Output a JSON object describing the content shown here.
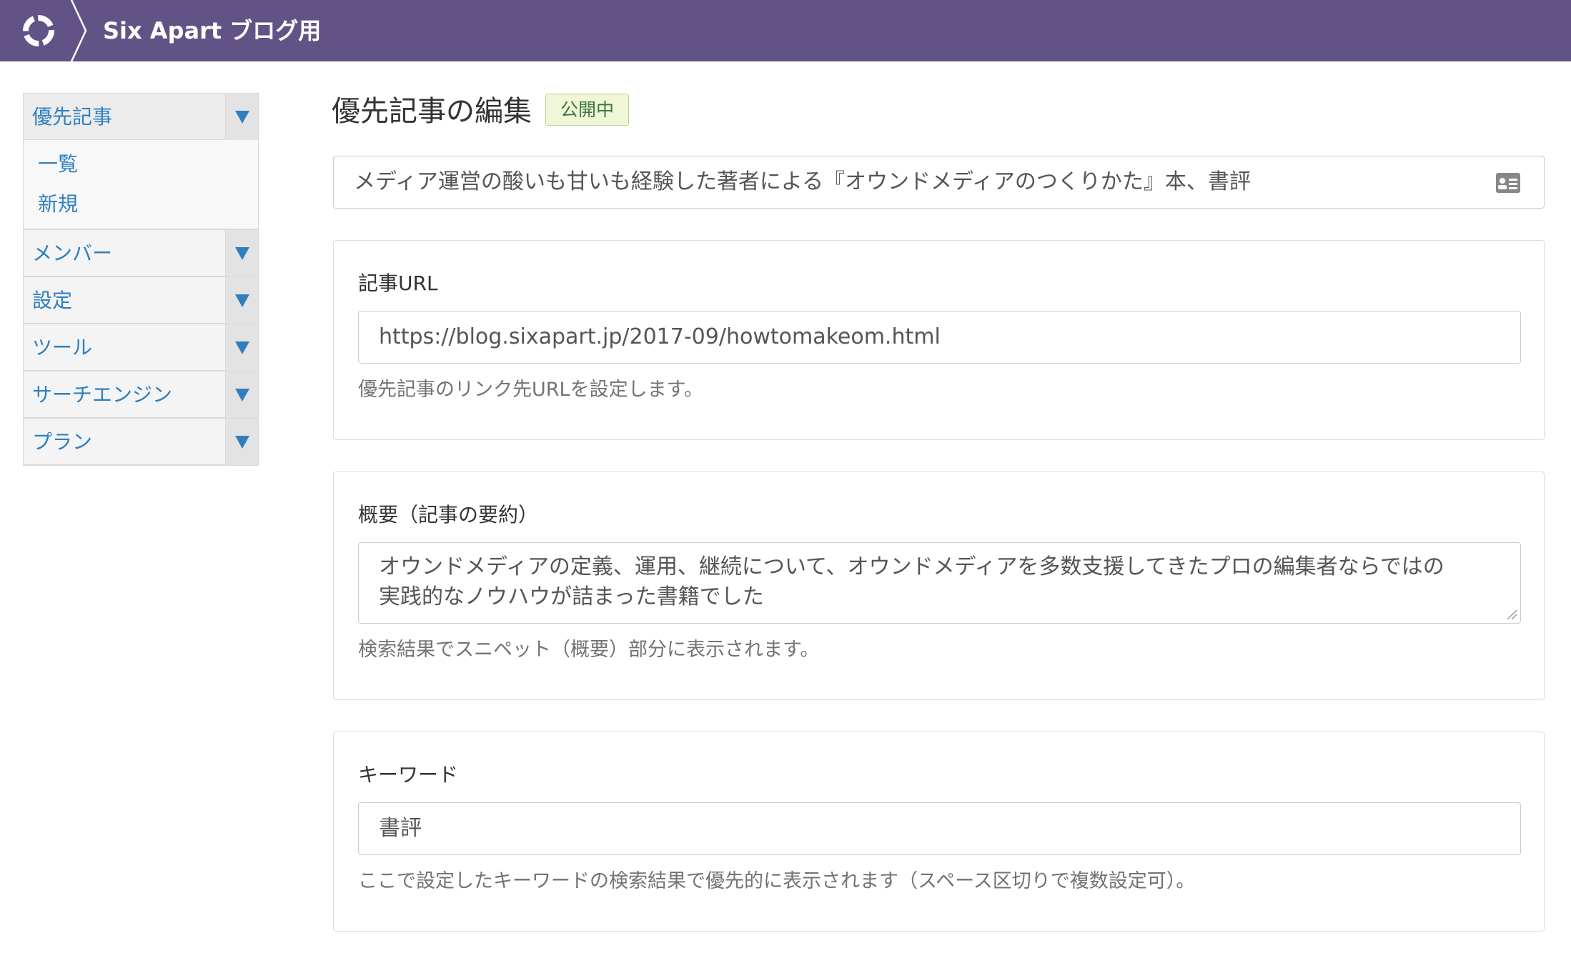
{
  "header": {
    "logo_icon": "sixapart-ring-icon",
    "site_title": "Six Apart ブログ用",
    "bar_color": "#625386"
  },
  "sidebar": {
    "groups": [
      {
        "label": "優先記事",
        "expanded": true,
        "items": [
          {
            "label": "一覧"
          },
          {
            "label": "新規"
          }
        ]
      },
      {
        "label": "メンバー",
        "expanded": false
      },
      {
        "label": "設定",
        "expanded": false
      },
      {
        "label": "ツール",
        "expanded": false
      },
      {
        "label": "サーチエンジン",
        "expanded": false
      },
      {
        "label": "プラン",
        "expanded": false
      }
    ],
    "toggle_icon": "triangle-down-icon",
    "link_color": "#2f7fbf"
  },
  "main": {
    "page_title": "優先記事の編集",
    "status_badge": "公開中",
    "article_title": "メディア運営の酸いも甘いも経験した著者による『オウンドメディアのつくりかた』本、書評",
    "article_title_icon": "id-card-icon",
    "url_section": {
      "label": "記事URL",
      "value": "https://blog.sixapart.jp/2017-09/howtomakeom.html",
      "help": "優先記事のリンク先URLを設定します。"
    },
    "summary_section": {
      "label": "概要（記事の要約）",
      "value_line1": "オウンドメディアの定義、運用、継続について、オウンドメディアを多数支援してきたプロの編集者ならではの",
      "value_line2": "実践的なノウハウが詰まった書籍でした",
      "help": "検索結果でスニペット（概要）部分に表示されます。"
    },
    "keyword_section": {
      "label": "キーワード",
      "value": "書評",
      "help": "ここで設定したキーワードの検索結果で優先的に表示されます（スペース区切りで複数設定可）。"
    }
  }
}
